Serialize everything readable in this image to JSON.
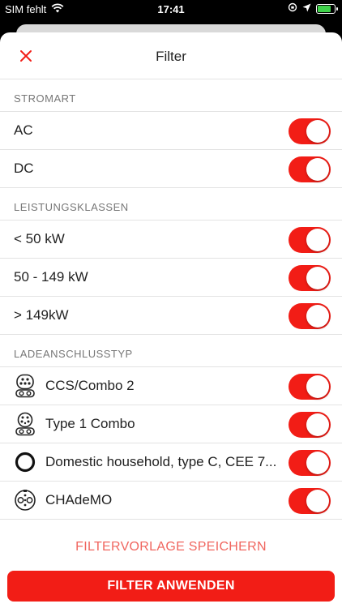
{
  "status_bar": {
    "carrier": "SIM fehlt",
    "time": "17:41"
  },
  "header": {
    "title": "Filter",
    "close_icon": "close-icon"
  },
  "sections": {
    "stromart": {
      "title": "STROMART",
      "items": [
        {
          "label": "AC",
          "enabled": true
        },
        {
          "label": "DC",
          "enabled": true
        }
      ]
    },
    "leistungsklassen": {
      "title": "LEISTUNGSKLASSEN",
      "items": [
        {
          "label": "< 50 kW",
          "enabled": true
        },
        {
          "label": "50 - 149 kW",
          "enabled": true
        },
        {
          "label": "> 149kW",
          "enabled": true
        }
      ]
    },
    "ladeanschlusstyp": {
      "title": "LADEANSCHLUSSTYP",
      "items": [
        {
          "label": "CCS/Combo 2",
          "icon": "ccs-combo2-plug-icon",
          "enabled": true
        },
        {
          "label": "Type 1 Combo",
          "icon": "type1-combo-plug-icon",
          "enabled": true
        },
        {
          "label": "Domestic household, type C, CEE 7...",
          "icon": "domestic-plug-icon",
          "enabled": true
        },
        {
          "label": "CHAdeMO",
          "icon": "chademo-plug-icon",
          "enabled": true
        }
      ]
    }
  },
  "footer": {
    "save_label": "FILTERVORLAGE SPEICHERN",
    "apply_label": "FILTER ANWENDEN"
  },
  "colors": {
    "accent": "#f21d16",
    "link": "#f0655e"
  }
}
